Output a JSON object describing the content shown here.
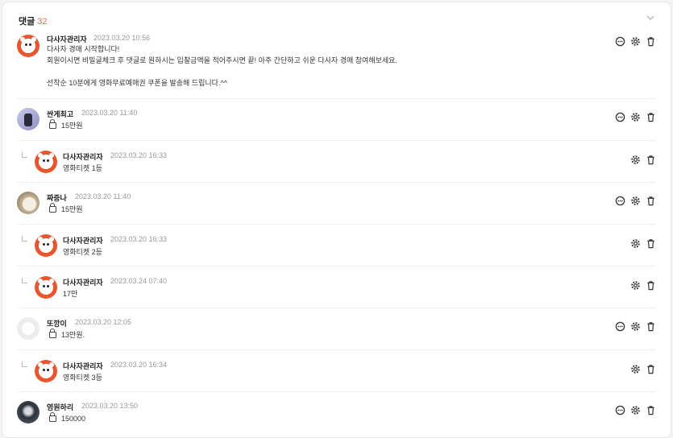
{
  "header": {
    "title": "댓글",
    "count": "32"
  },
  "comments": [
    {
      "name": "다사자관리자",
      "date": "2023.03.20 10:56",
      "lines": [
        "다사자 경매 시작합니다!",
        "회원이시면 비밀글체크 후 댓글로 원하시는 입찰금액을 적어주시면 끝! 아주 간단하고 쉬운 다사자 경매 참여해보세요.",
        "",
        "선착순 10분에게 영화무료예매권 쿠폰을 발송해 드립니다.^^"
      ]
    },
    {
      "name": "싼게최고",
      "date": "2023.03.20 11:40",
      "text": "15만원"
    },
    {
      "name": "다사자관리자",
      "date": "2023.03.20 16:33",
      "text": "영화티켓 1등"
    },
    {
      "name": "짜증나",
      "date": "2023.03.20 11:40",
      "text": "15만원"
    },
    {
      "name": "다사자관리자",
      "date": "2023.03.20 16:33",
      "text": "영화티켓 2등"
    },
    {
      "name": "다사자관리자",
      "date": "2023.03.24 07:40",
      "text": "17만"
    },
    {
      "name": "또깡이",
      "date": "2023.03.20 12:05",
      "text": "13만원."
    },
    {
      "name": "다사자관리자",
      "date": "2023.03.20 16:34",
      "text": "영화티켓 3등"
    },
    {
      "name": "영원하리",
      "date": "2023.03.20 13:50",
      "text": "150000"
    }
  ]
}
